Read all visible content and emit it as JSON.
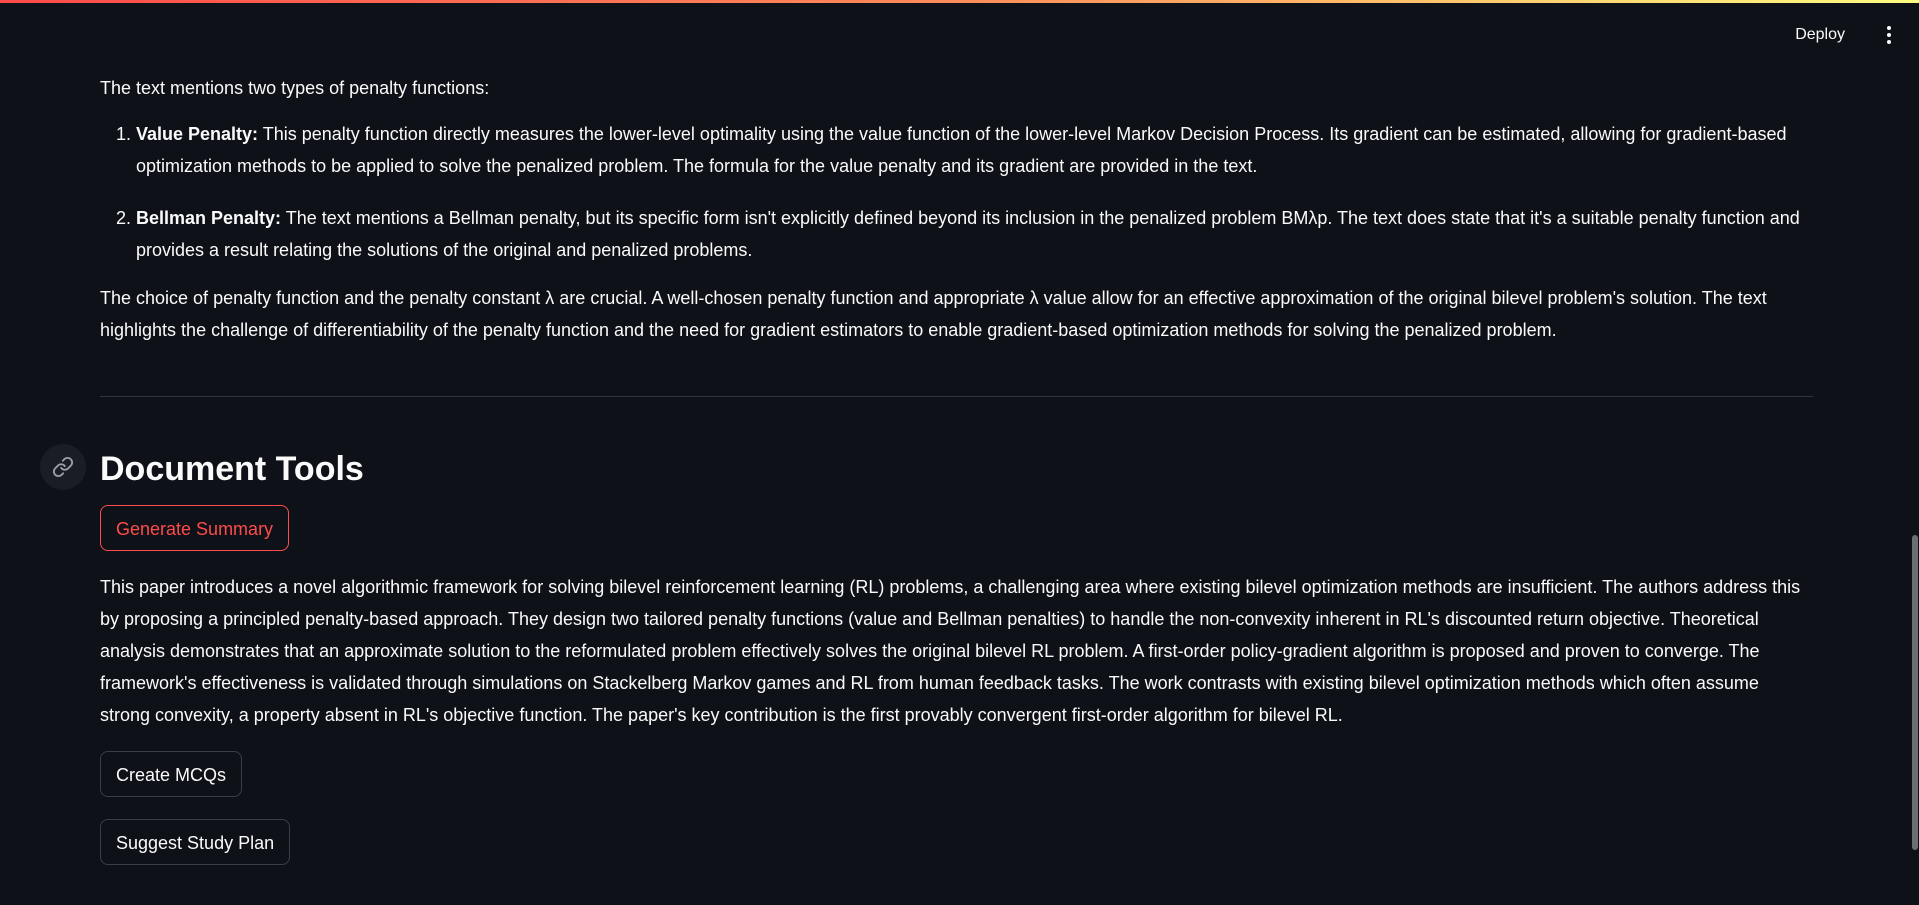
{
  "header": {
    "deploy_label": "Deploy",
    "menu_icon": "kebab-menu-icon"
  },
  "content": {
    "intro": "The text mentions two types of penalty functions:",
    "penalties": [
      {
        "title": "Value Penalty:",
        "text": " This penalty function directly measures the lower-level optimality using the value function of the lower-level Markov Decision Process. Its gradient can be estimated, allowing for gradient-based optimization methods to be applied to solve the penalized problem. The formula for the value penalty and its gradient are provided in the text."
      },
      {
        "title": "Bellman Penalty:",
        "text": " The text mentions a Bellman penalty, but its specific form isn't explicitly defined beyond its inclusion in the penalized problem BMλp. The text does state that it's a suitable penalty function and provides a result relating the solutions of the original and penalized problems."
      }
    ],
    "choice_paragraph": "The choice of penalty function and the penalty constant λ are crucial. A well-chosen penalty function and appropriate λ value allow for an effective approximation of the original bilevel problem's solution. The text highlights the challenge of differentiability of the penalty function and the need for gradient estimators to enable gradient-based optimization methods for solving the penalized problem."
  },
  "tools": {
    "heading": "Document Tools",
    "anchor_icon": "link-icon",
    "generate_summary_label": "Generate Summary",
    "summary_text": "This paper introduces a novel algorithmic framework for solving bilevel reinforcement learning (RL) problems, a challenging area where existing bilevel optimization methods are insufficient. The authors address this by proposing a principled penalty-based approach. They design two tailored penalty functions (value and Bellman penalties) to handle the non-convexity inherent in RL's discounted return objective. Theoretical analysis demonstrates that an approximate solution to the reformulated problem effectively solves the original bilevel RL problem. A first-order policy-gradient algorithm is proposed and proven to converge. The framework's effectiveness is validated through simulations on Stackelberg Markov games and RL from human feedback tasks. The work contrasts with existing bilevel optimization methods which often assume strong convexity, a property absent in RL's objective function. The paper's key contribution is the first provably convergent first-order algorithm for bilevel RL.",
    "create_mcqs_label": "Create MCQs",
    "suggest_study_plan_label": "Suggest Study Plan"
  },
  "colors": {
    "background": "#0e1117",
    "text": "#fafafa",
    "accent": "#ff4b4b",
    "divider": "#31333f"
  }
}
